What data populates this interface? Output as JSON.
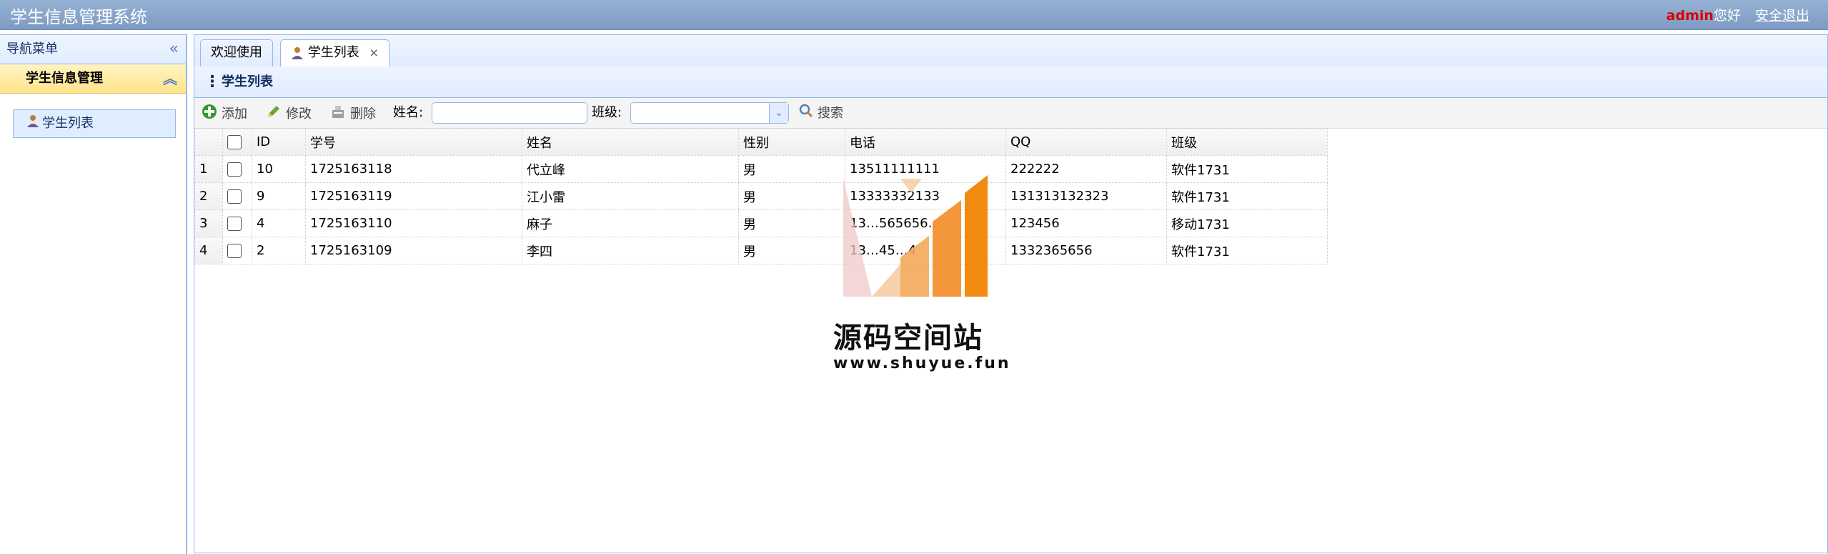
{
  "header": {
    "app_title": "学生信息管理系统",
    "username": "admin",
    "greeting": "您好",
    "logout_label": "安全退出"
  },
  "sidebar": {
    "title": "导航菜单",
    "group_title": "学生信息管理",
    "items": [
      {
        "label": "学生列表",
        "icon": "user-icon"
      }
    ]
  },
  "tabs": [
    {
      "label": "欢迎使用"
    },
    {
      "label": "学生列表",
      "icon": "user-icon",
      "close": "×"
    }
  ],
  "panel": {
    "title": "学生列表"
  },
  "toolbar": {
    "add_label": "添加",
    "edit_label": "修改",
    "delete_label": "删除",
    "name_label": "姓名:",
    "name_value": "",
    "class_label": "班级:",
    "class_value": "",
    "search_label": "搜索"
  },
  "grid": {
    "columns": [
      "ID",
      "学号",
      "姓名",
      "性别",
      "电话",
      "QQ",
      "班级"
    ],
    "rows": [
      {
        "n": "1",
        "id": "10",
        "sno": "1725163118",
        "name": "代立峰",
        "sex": "男",
        "phone": "13511111111",
        "qq": "222222",
        "cls": "软件1731"
      },
      {
        "n": "2",
        "id": "9",
        "sno": "1725163119",
        "name": "江小雷",
        "sex": "男",
        "phone": "13333332133",
        "qq": "131313132323",
        "cls": "软件1731"
      },
      {
        "n": "3",
        "id": "4",
        "sno": "1725163110",
        "name": "麻子",
        "sex": "男",
        "phone": "13…565656…",
        "qq": "123456",
        "cls": "移动1731"
      },
      {
        "n": "4",
        "id": "2",
        "sno": "1725163109",
        "name": "李四",
        "sex": "男",
        "phone": "13…45…4",
        "qq": "1332365656",
        "cls": "软件1731"
      }
    ]
  },
  "watermark": {
    "title": "源码空间站",
    "url": "www.shuyue.fun"
  },
  "colors": {
    "header_bg": "#7d9bc3",
    "accent_border": "#95b8e7",
    "group_bg": "#ffe48d",
    "username": "#d90000"
  }
}
